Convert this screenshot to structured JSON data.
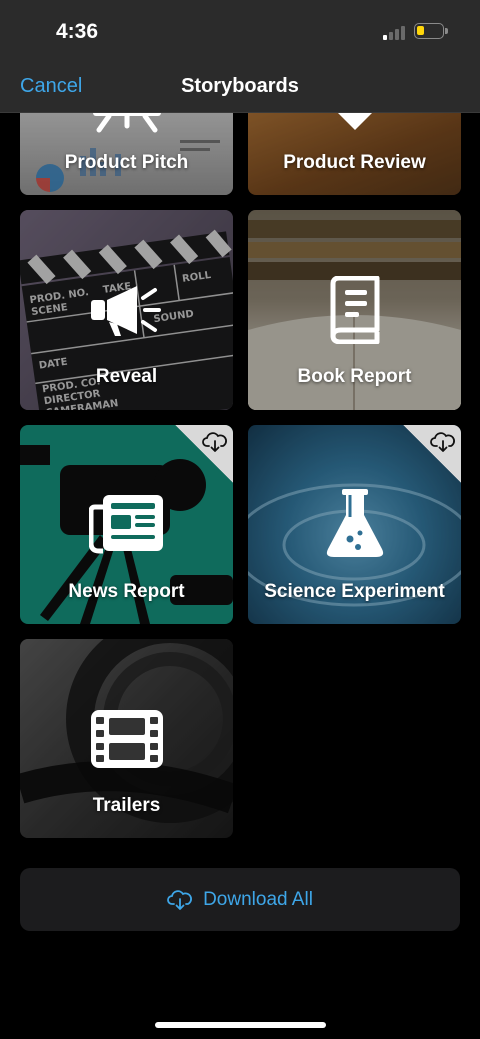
{
  "status": {
    "time": "4:36"
  },
  "nav": {
    "cancel_label": "Cancel",
    "title": "Storyboards"
  },
  "tiles": [
    {
      "label": "Product Pitch",
      "icon": "presentation-icon",
      "cloud": false
    },
    {
      "label": "Product Review",
      "icon": "thumbs-badge-icon",
      "cloud": false
    },
    {
      "label": "Reveal",
      "icon": "megaphone-icon",
      "cloud": false
    },
    {
      "label": "Book Report",
      "icon": "book-icon",
      "cloud": false
    },
    {
      "label": "News Report",
      "icon": "newspaper-icon",
      "cloud": true
    },
    {
      "label": "Science Experiment",
      "icon": "flask-icon",
      "cloud": true
    },
    {
      "label": "Trailers",
      "icon": "film-icon",
      "cloud": false
    }
  ],
  "clapper_text": [
    "PROD. NO.",
    "SCENE",
    "TAKE",
    "ROLL",
    "SOUND",
    "DATE",
    "PROD. CO.",
    "DIRECTOR",
    "CAMERAMAN"
  ],
  "download_all": {
    "label": "Download All",
    "icon": "cloud-download-icon"
  },
  "colors": {
    "accent": "#3ea6e8",
    "bar": "#2b2b2b",
    "button_bg": "#1c1c1e"
  }
}
